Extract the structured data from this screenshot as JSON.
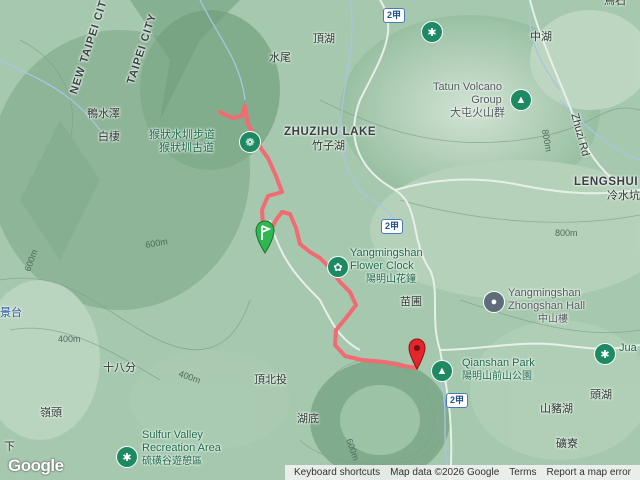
{
  "map": {
    "route_color": "#f26a72",
    "water_color": "#a9c5e0",
    "terrain_color": "#9fc4a8",
    "labels": {
      "new_taipei": "NEW TAIPEI CITY",
      "taipei": "TAIPEI CITY",
      "shuiwei": "水尾",
      "dinghu": "頂湖",
      "yashuize": "鴨水澤",
      "baitang": "白棲",
      "zhuzihu_en": "ZHUZIHU LAKE",
      "zhuzihu_zh": "竹子湖",
      "tatun_en1": "Tatun Volcano",
      "tatun_en2": "Group",
      "tatun_zh": "大屯火山群",
      "zhonghu": "中湖",
      "zhuzi_rd": "Zhuzi Rd",
      "lengshui_en": "LENGSHUI",
      "lengshui_zh": "冷水坑",
      "houshan_zh1": "猴狀水圳步道",
      "houshan_zh2": "猴狀圳古道",
      "clock_en1": "Yangmingshan",
      "clock_en2": "Flower Clock",
      "clock_zh": "陽明山花鐘",
      "miaopu": "苗圃",
      "zhongshan_en1": "Yangmingshan",
      "zhongshan_en2": "Zhongshan Hall",
      "zhongshan_zh": "中山樓",
      "qianshan_en": "Qianshan Park",
      "qianshan_zh": "陽明山前山公園",
      "jingtai": "景台",
      "shibafen": "十八分",
      "dingbeitou": "頂北投",
      "lingtou": "嶺頭",
      "hudi": "湖底",
      "shanzhuhu": "山豬湖",
      "toufen": "頭湖",
      "sulfur_en1": "Sulfur Valley",
      "sulfur_en2": "Recreation Area",
      "sulfur_zh": "硫磺谷遊憩區",
      "shaliao": "礦寮",
      "ju": "Jua",
      "xia": "下",
      "niaoshi": "鳥石"
    },
    "contours": [
      "600m",
      "600m",
      "400m",
      "400m",
      "600m",
      "800m",
      "800m"
    ],
    "route_shields": [
      "2甲",
      "2甲",
      "2甲"
    ]
  },
  "footer": {
    "logo": "Google",
    "links": [
      "Keyboard shortcuts",
      "Map data ©2026 Google",
      "Terms",
      "Report a map error"
    ]
  }
}
